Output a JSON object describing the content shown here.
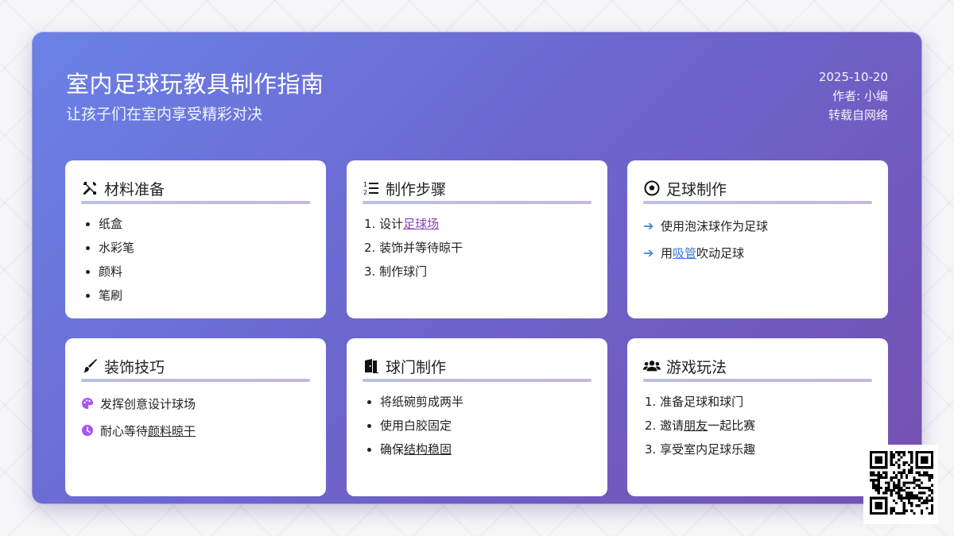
{
  "header": {
    "title": "室内足球玩教具制作指南",
    "subtitle": "让孩子们在室内享受精彩对决",
    "date": "2025-10-20",
    "author": "作者: 小编",
    "source": "转载自网络"
  },
  "cards": {
    "materials": {
      "title": "材料准备",
      "icon": "tools-icon",
      "items": [
        "纸盒",
        "水彩笔",
        "颜料",
        "笔刷"
      ]
    },
    "steps": {
      "title": "制作步骤",
      "icon": "numbered-list-icon",
      "item1_prefix": "1. 设计",
      "item1_link": "足球场",
      "item2": "2. 装饰并等待晾干",
      "item3": "3. 制作球门"
    },
    "ball": {
      "title": "足球制作",
      "icon": "soccer-ball-icon",
      "item1": "使用泡沫球作为足球",
      "item2_prefix": "用",
      "item2_link": "吸管",
      "item2_suffix": "吹动足球"
    },
    "decor": {
      "title": "装饰技巧",
      "icon": "paintbrush-icon",
      "item1": "发挥创意设计球场",
      "item2_prefix": "耐心等待",
      "item2_link": "颜料晾干"
    },
    "goal": {
      "title": "球门制作",
      "icon": "door-icon",
      "item1": "将纸碗剪成两半",
      "item2": "使用白胶固定",
      "item3_prefix": "确保",
      "item3_link": "结构稳固"
    },
    "play": {
      "title": "游戏玩法",
      "icon": "users-icon",
      "item1": "1. 准备足球和球门",
      "item2_prefix": "2. 邀请",
      "item2_link": "朋友",
      "item2_suffix": "一起比赛",
      "item3": "3. 享受室内足球乐趣"
    }
  },
  "colors": {
    "gradient_start": "#6b82e6",
    "gradient_end": "#7550b0",
    "link_purple": "#8a3fb8",
    "link_blue": "#3a7bd5",
    "accent_icon": "#a855f7"
  }
}
